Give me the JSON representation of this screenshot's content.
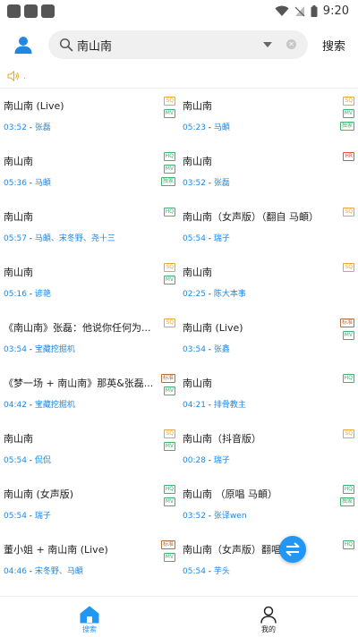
{
  "status_bar": {
    "time": "9:20"
  },
  "header": {
    "search_query": "南山南",
    "search_button": "搜索"
  },
  "notice": {
    "text": "."
  },
  "songs": [
    {
      "title": "南山南 (Live)",
      "duration": "03:52",
      "artist": "张磊",
      "tags": [
        "SQ",
        "MV"
      ]
    },
    {
      "title": "南山南",
      "duration": "05:23",
      "artist": "马頔",
      "tags": [
        "SQ",
        "MV",
        "独家"
      ]
    },
    {
      "title": "南山南",
      "duration": "05:36",
      "artist": "马頔",
      "tags": [
        "HQ",
        "MV",
        "独家"
      ]
    },
    {
      "title": "南山南",
      "duration": "03:52",
      "artist": "张磊",
      "tags": [
        "HR"
      ]
    },
    {
      "title": "南山南",
      "duration": "05:57",
      "artist": "马頔、宋冬野、尧十三",
      "tags": [
        "HQ"
      ]
    },
    {
      "title": "南山南（女声版）（翻自 马頔）",
      "duration": "05:54",
      "artist": "瑞子",
      "tags": [
        "SQ"
      ]
    },
    {
      "title": "南山南",
      "duration": "05:16",
      "artist": "谚艳",
      "tags": [
        "SQ",
        "MV"
      ]
    },
    {
      "title": "南山南",
      "duration": "02:25",
      "artist": "陈大本事",
      "tags": [
        "SQ"
      ]
    },
    {
      "title": "《南山南》张磊：他说你任何为...",
      "duration": "03:54",
      "artist": "宝藏挖掘机",
      "tags": [
        "SQ"
      ]
    },
    {
      "title": "南山南 (Live)",
      "duration": "03:54",
      "artist": "张鑫",
      "tags": [
        "标准",
        "MV"
      ]
    },
    {
      "title": "《梦一场 + 南山南》那英&张磊...",
      "duration": "04:42",
      "artist": "宝藏挖掘机",
      "tags": [
        "标准",
        "MV"
      ]
    },
    {
      "title": "南山南",
      "duration": "04:21",
      "artist": "排骨教主",
      "tags": [
        "HQ"
      ]
    },
    {
      "title": "南山南",
      "duration": "05:54",
      "artist": "侃侃",
      "tags": [
        "SQ",
        "MV"
      ]
    },
    {
      "title": "南山南（抖音版）",
      "duration": "00:28",
      "artist": "瑞子",
      "tags": [
        "SQ"
      ]
    },
    {
      "title": "南山南 (女声版)",
      "duration": "05:54",
      "artist": "瑞子",
      "tags": [
        "HQ",
        "MV"
      ]
    },
    {
      "title": "南山南 （原唱 马頔）",
      "duration": "03:52",
      "artist": "张译wen",
      "tags": [
        "HQ",
        "独家"
      ]
    },
    {
      "title": "董小姐 + 南山南 (Live)",
      "duration": "04:46",
      "artist": "宋冬野、马頔",
      "tags": [
        "标准",
        "MV"
      ]
    },
    {
      "title": "南山南（女声版）翻唱",
      "duration": "05:54",
      "artist": "芋头",
      "tags": [
        "HQ"
      ]
    }
  ],
  "bottom_nav": {
    "search_label": "搜索",
    "mine_label": "我的"
  },
  "colors": {
    "accent": "#2196f3",
    "link": "#1e88e5",
    "sq": "#e6a43d",
    "hq": "#43b06f",
    "hr": "#d9534f"
  }
}
